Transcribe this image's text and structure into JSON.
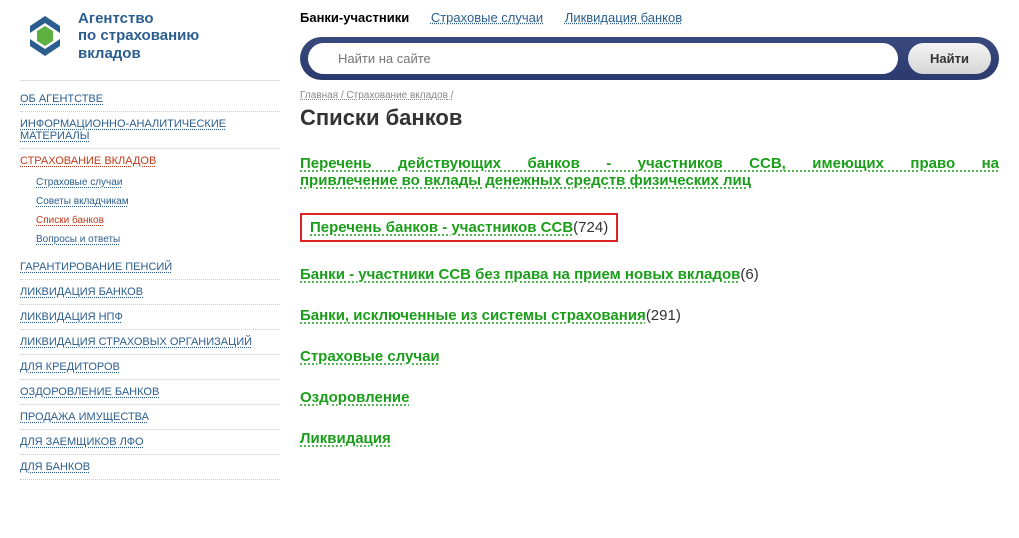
{
  "brand": {
    "line1": "Агентство",
    "line2": "по страхованию",
    "line3": "вкладов"
  },
  "topnav": {
    "banks": "Банки-участники",
    "cases": "Страховые случаи",
    "liquidation": "Ликвидация банков"
  },
  "search": {
    "placeholder": "Найти на сайте",
    "button": "Найти"
  },
  "sidebar": {
    "about": "ОБ АГЕНТСТВЕ",
    "materials": "ИНФОРМАЦИОННО-АНАЛИТИЧЕСКИЕ МАТЕРИАЛЫ",
    "insurance": "СТРАХОВАНИЕ ВКЛАДОВ",
    "sub": {
      "cases": "Страховые случаи",
      "advice": "Советы вкладчикам",
      "lists": "Списки банков",
      "qa": "Вопросы и ответы"
    },
    "pension": "ГАРАНТИРОВАНИЕ ПЕНСИЙ",
    "liq_banks": "ЛИКВИДАЦИЯ БАНКОВ",
    "liq_npf": "ЛИКВИДАЦИЯ НПФ",
    "liq_ins": "ЛИКВИДАЦИЯ СТРАХОВЫХ ОРГАНИЗАЦИЙ",
    "creditors": "ДЛЯ КРЕДИТОРОВ",
    "health": "ОЗДОРОВЛЕНИЕ БАНКОВ",
    "property": "ПРОДАЖА ИМУЩЕСТВА",
    "borrowers": "ДЛЯ ЗАЕМЩИКОВ ЛФО",
    "for_banks": "ДЛЯ БАНКОВ"
  },
  "breadcrumb": {
    "home": "Главная",
    "ins": "Страхование вкладов",
    "sep": " / "
  },
  "title": "Списки банков",
  "links": {
    "full_line1": "Перечень действующих банков - участников ССВ, имеющих право на",
    "full_line2": "привлечение во вклады денежных средств физических лиц",
    "participants": "Перечень банков - участников ССВ",
    "participants_count": "(724)",
    "no_new": "Банки - участники ССВ без права на прием новых вкладов",
    "no_new_count": "(6)",
    "excluded": "Банки, исключенные из системы страхования",
    "excluded_count": "(291)",
    "cases": "Страховые случаи",
    "health": "Оздоровление",
    "liquidation": "Ликвидация"
  }
}
